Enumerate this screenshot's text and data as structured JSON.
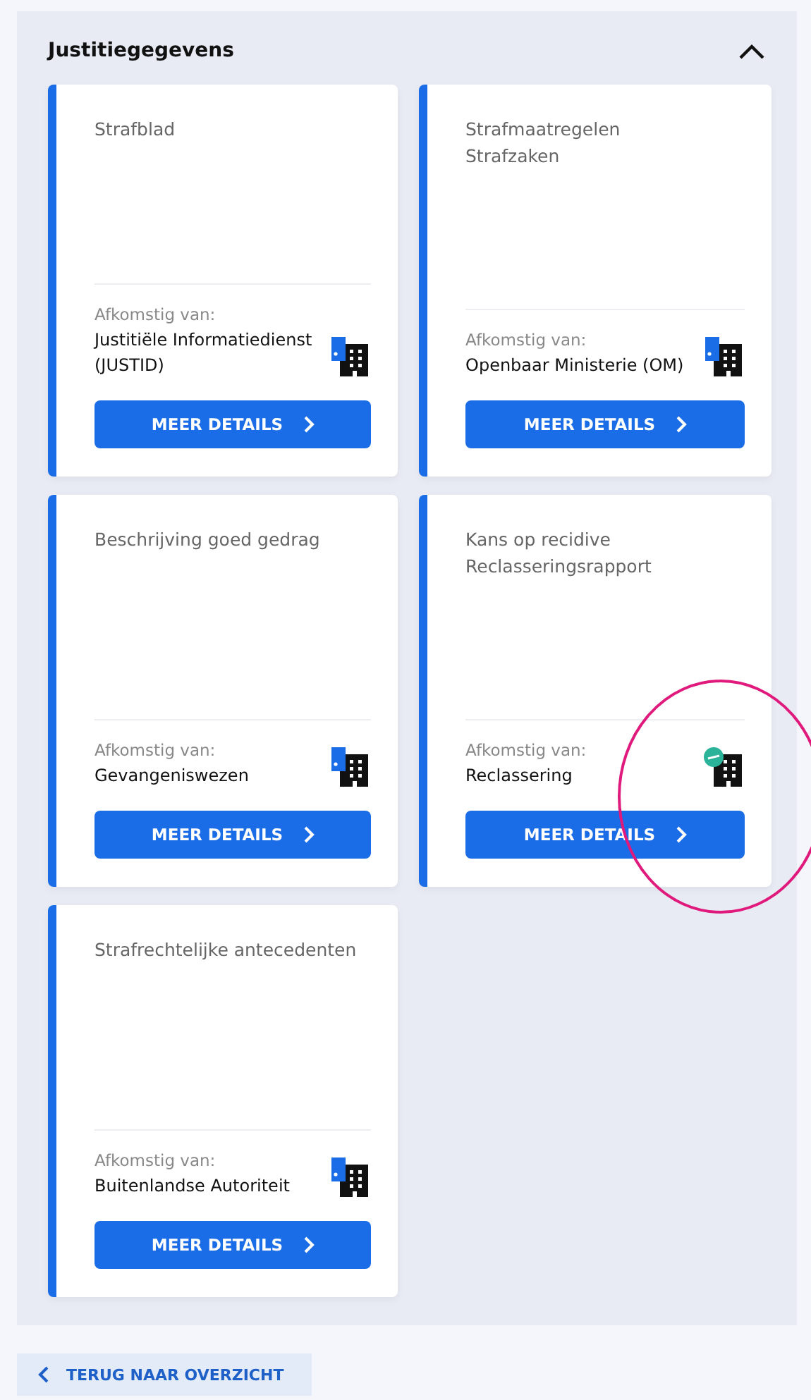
{
  "section": {
    "title": "Justitiegegevens",
    "expanded": true
  },
  "cards": [
    {
      "title": "Strafblad",
      "source_label": "Afkomstig van:",
      "source": "Justitiële Informatiedienst (JUSTID)",
      "kind": "flag",
      "button": "MEER DETAILS",
      "highlighted": false
    },
    {
      "title": "Strafmaatregelen\nStrafzaken",
      "source_label": "Afkomstig van:",
      "source": "Openbaar Ministerie (OM)",
      "kind": "flag",
      "button": "MEER DETAILS",
      "highlighted": false
    },
    {
      "title": "Beschrijving goed gedrag",
      "source_label": "Afkomstig van:",
      "source": "Gevangeniswezen",
      "kind": "flag",
      "button": "MEER DETAILS",
      "highlighted": false
    },
    {
      "title": "Kans op recidive\nReclasseringsrapport",
      "source_label": "Afkomstig van:",
      "source": "Reclassering",
      "kind": "badge",
      "button": "MEER DETAILS",
      "highlighted": true
    },
    {
      "title": "Strafrechtelijke antecedenten",
      "source_label": "Afkomstig van:",
      "source": "Buitenlandse Autoriteit",
      "kind": "flag",
      "button": "MEER DETAILS",
      "highlighted": false
    }
  ],
  "back_button": "TERUG NAAR OVERZICHT"
}
